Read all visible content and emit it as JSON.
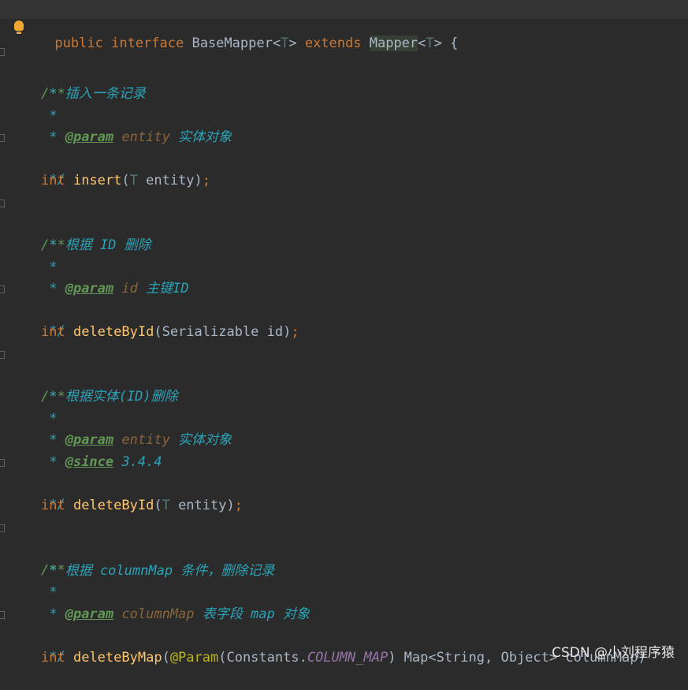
{
  "header": {
    "public": "public",
    "interface": "interface",
    "name": "BaseMapper",
    "lt": "<",
    "t": "T",
    "gt": ">",
    "extends": "extends",
    "mapper": "Mapper",
    "lt2": "<",
    "t2": "T",
    "gt2": ">",
    "brace": " {"
  },
  "blocks": {
    "b1": {
      "open": "/**",
      "desc": " * 插入一条记录",
      "star": " *",
      "param_tag": "@param",
      "param_name": "entity",
      "param_desc": "实体对象",
      "close": " */",
      "ret": "int",
      "method": "insert",
      "paren_open": "(",
      "arg_type": "T",
      "arg_name": " entity",
      "paren_close": ")",
      "semi": ";"
    },
    "b2": {
      "open": "/**",
      "desc": " * 根据 ID 删除",
      "star": " *",
      "param_tag": "@param",
      "param_name": "id",
      "param_desc": "主键ID",
      "close": " */",
      "ret": "int",
      "method": "deleteById",
      "paren_open": "(",
      "arg": "Serializable id",
      "paren_close": ")",
      "semi": ";"
    },
    "b3": {
      "open": "/**",
      "desc": " * 根据实体(ID)删除",
      "star": " *",
      "param_tag": "@param",
      "param_name": "entity",
      "param_desc": "实体对象",
      "since_tag": "@since",
      "since_val": "3.4.4",
      "close": " */",
      "ret": "int",
      "method": "deleteById",
      "paren_open": "(",
      "arg_type": "T",
      "arg_name": " entity",
      "paren_close": ")",
      "semi": ";"
    },
    "b4": {
      "open": "/**",
      "desc": " * 根据 columnMap 条件，删除记录",
      "star": " *",
      "param_tag": "@param",
      "param_name": "columnMap",
      "param_desc": "表字段 map 对象",
      "close": " */",
      "ret": "int",
      "method": "deleteByMap",
      "paren_open": "(",
      "anno": "@Param",
      "anno_open": "(Constants.",
      "const": "COLUMN_MAP",
      "anno_close": ") Map<String, Object> columnMap)"
    }
  },
  "watermark": "CSDN @小刘程序猿"
}
